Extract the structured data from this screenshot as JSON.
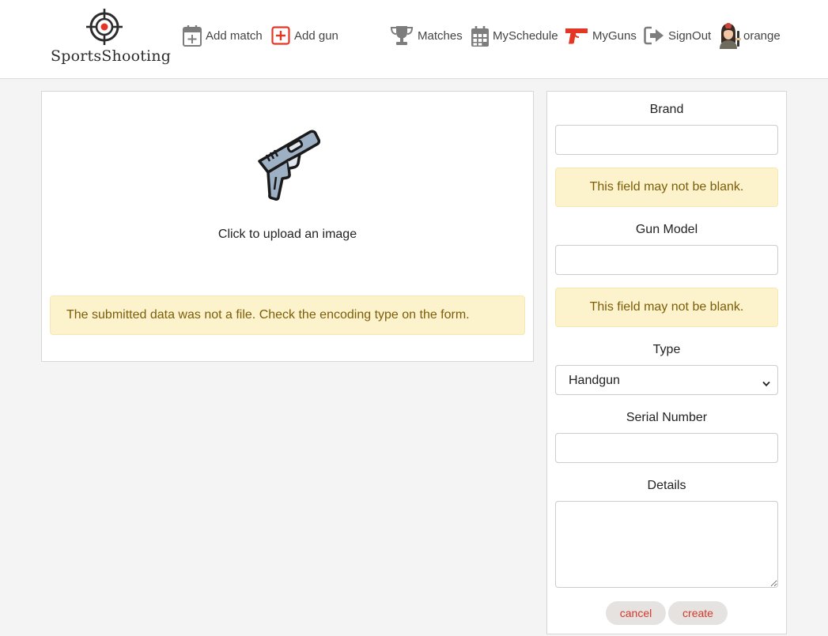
{
  "brand": {
    "name": "SportsShooting",
    "accent_color": "#e53524"
  },
  "nav": {
    "add_match": "Add match",
    "add_gun": "Add gun",
    "matches": "Matches",
    "my_schedule": "MySchedule",
    "my_guns": "MyGuns",
    "sign_out": "SignOut",
    "username": "orange",
    "icons": [
      "calendar-plus-icon",
      "plus-square-icon",
      "trophy-icon",
      "calendar-icon",
      "gun-icon",
      "sign-out-icon",
      "avatar"
    ]
  },
  "upload": {
    "prompt": "Click to upload an image",
    "error": "The submitted data was not a file. Check the encoding type on the form."
  },
  "form": {
    "brand_label": "Brand",
    "brand_value": "",
    "brand_error": "This field may not be blank.",
    "model_label": "Gun Model",
    "model_value": "",
    "model_error": "This field may not be blank.",
    "type_label": "Type",
    "type_selected": "Handgun",
    "serial_label": "Serial Number",
    "serial_value": "",
    "details_label": "Details",
    "details_value": "",
    "cancel_label": "cancel",
    "create_label": "create"
  },
  "colors": {
    "alert_background": "#fcf2cc",
    "alert_text": "#7c5e08",
    "button_text": "#d2382c",
    "button_background": "#e6e2df",
    "nav_icon_gray": "#7d7d7d"
  }
}
